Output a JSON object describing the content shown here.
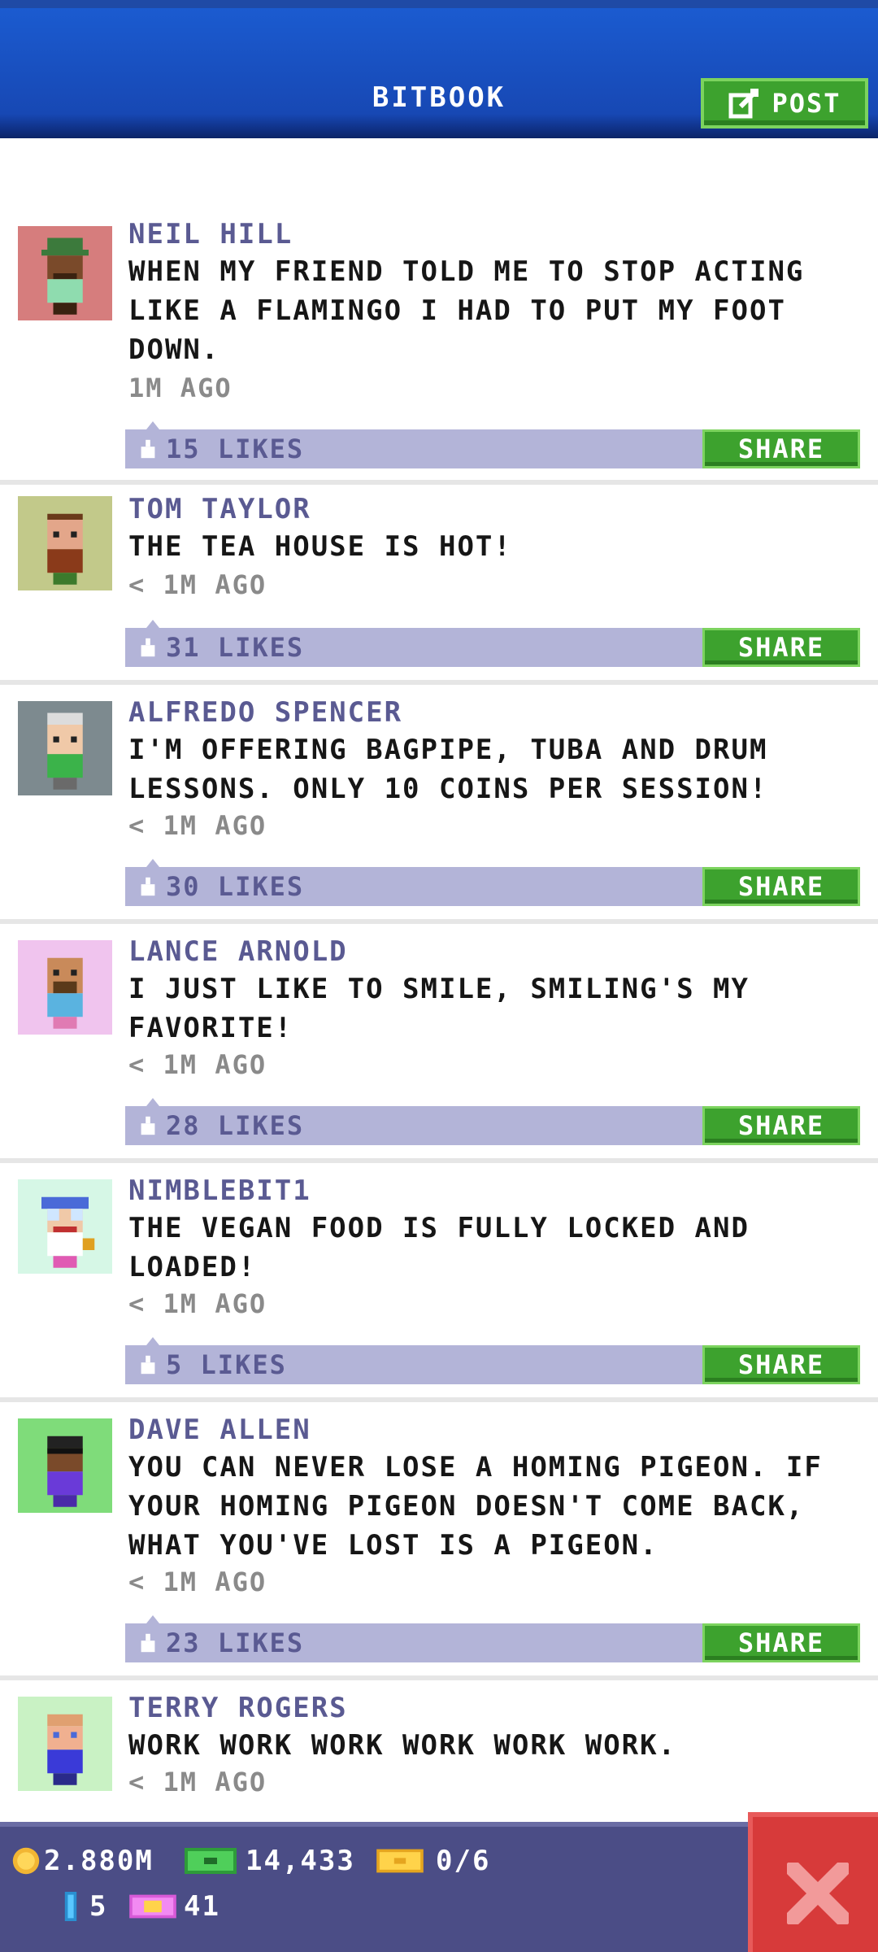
{
  "header": {
    "title": "BITBOOK",
    "post_label": "POST"
  },
  "posts": [
    {
      "author": "NEIL HILL",
      "text": "WHEN MY FRIEND TOLD ME TO STOP ACTING LIKE A FLAMINGO I HAD TO PUT MY FOOT DOWN.",
      "time": "1M AGO",
      "likes": "15 LIKES",
      "share": "SHARE"
    },
    {
      "author": "TOM TAYLOR",
      "text": "THE TEA HOUSE IS HOT!",
      "time": "< 1M AGO",
      "likes": "31 LIKES",
      "share": "SHARE"
    },
    {
      "author": "ALFREDO SPENCER",
      "text": "I'M OFFERING BAGPIPE, TUBA AND DRUM LESSONS. ONLY 10 COINS PER SESSION!",
      "time": "< 1M AGO",
      "likes": "30 LIKES",
      "share": "SHARE"
    },
    {
      "author": "LANCE ARNOLD",
      "text": "I JUST LIKE TO SMILE, SMILING'S MY FAVORITE!",
      "time": "< 1M AGO",
      "likes": "28 LIKES",
      "share": "SHARE"
    },
    {
      "author": "NIMBLEBIT1",
      "text": "THE VEGAN FOOD IS FULLY LOCKED AND LOADED!",
      "time": "< 1M AGO",
      "likes": "5 LIKES",
      "share": "SHARE"
    },
    {
      "author": "DAVE ALLEN",
      "text": "YOU CAN NEVER LOSE A HOMING PIGEON. IF YOUR HOMING PIGEON DOESN'T COME BACK, WHAT YOU'VE LOST IS A PIGEON.",
      "time": "< 1M AGO",
      "likes": "23 LIKES",
      "share": "SHARE"
    },
    {
      "author": "TERRY ROGERS",
      "text": "WORK WORK WORK WORK WORK WORK.",
      "time": "< 1M AGO"
    }
  ],
  "stats": {
    "coins": "2.880M",
    "bux": "14,433",
    "tickets": "0/6",
    "keys": "5",
    "vip": "41"
  },
  "colors": {
    "header_blue": "#1748b4",
    "share_green": "#3da22e",
    "likes_bar": "#b3b4d8",
    "author_purple": "#5a5a92",
    "close_red": "#d73a3a"
  }
}
